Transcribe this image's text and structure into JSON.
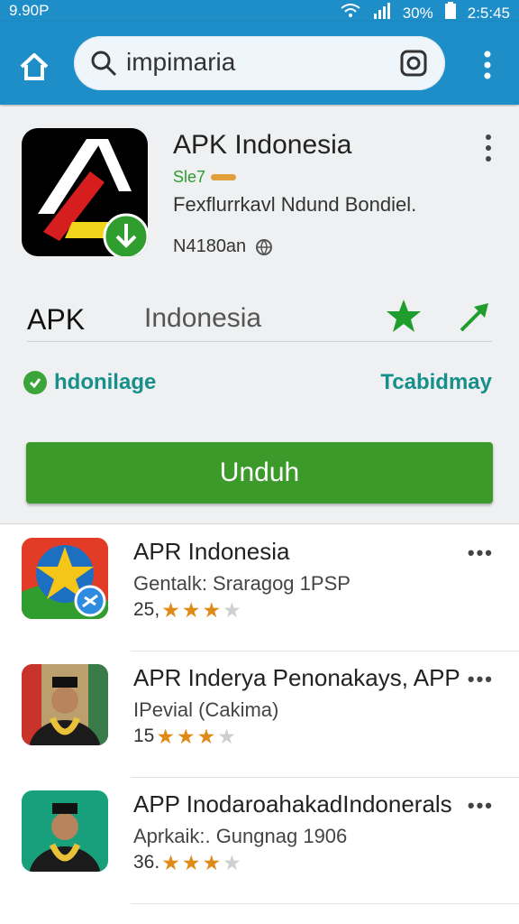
{
  "status": {
    "left": "9.90P",
    "battery": "30%",
    "time": "2:5:45"
  },
  "search": {
    "query": "impimaria"
  },
  "app": {
    "title": "APK Indonesia",
    "version": "Sle7",
    "description": "Fexflurrkavl Ndund Bondiel.",
    "meta": "N4180an",
    "name_left": "APK",
    "name_right": "Indonesia",
    "verified_label": "hdonilage",
    "right_tag": "Tcabidmay",
    "download_label": "Unduh"
  },
  "list": [
    {
      "name": "APR Indonesia",
      "sub": "Gentalk: Sraragog 1PSP",
      "count": "25,",
      "stars": 3,
      "icon": "star-globe-icon"
    },
    {
      "name": "APR Inderya Penonakays, APP",
      "sub": "IPevial (Cakima)",
      "count": "15",
      "stars": 3,
      "icon": "person-portrait-icon"
    },
    {
      "name": "APP InodaroahakadIndonerals",
      "sub": "Aprkaik:. Gungnag 1906",
      "count": "36.",
      "stars": 3,
      "icon": "person-portrait-icon"
    }
  ],
  "colors": {
    "appbar": "#1e8ec8",
    "download_button": "#3c9a2a",
    "teal_text": "#178f8a",
    "star": "#e08a17"
  }
}
